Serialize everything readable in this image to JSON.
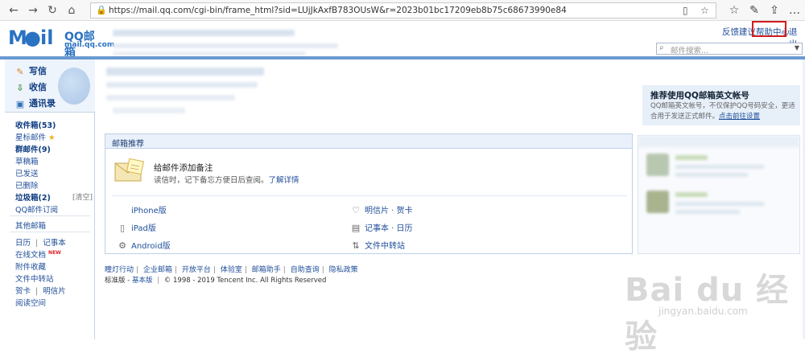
{
  "browser": {
    "url": "https://mail.qq.com/cgi-bin/frame_html?sid=LUjJkAxfB783OUsW&r=2023b01bc17209eb8b75c68673990e84"
  },
  "header": {
    "logo_text": "M",
    "logo_brand": "QQ邮箱",
    "logo_url": "mail.qq.com",
    "links": {
      "feedback": "反馈建议",
      "help": "帮助中心",
      "logout": "退出"
    },
    "search_placeholder": "邮件搜索..."
  },
  "sidebar": {
    "actions": {
      "compose": "写信",
      "inbox": "收信",
      "contacts": "通讯录"
    },
    "folders": [
      {
        "label": "收件箱(53)"
      },
      {
        "label": "星标邮件"
      },
      {
        "label": "群邮件(9)"
      },
      {
        "label": "草稿箱"
      },
      {
        "label": "已发送"
      },
      {
        "label": "已删除"
      },
      {
        "label": "垃圾箱(2)"
      },
      {
        "label": "QQ邮件订阅"
      }
    ],
    "clear_label": "[清空]",
    "other_mailbox": "其他邮箱",
    "tools": {
      "calendar": "日历",
      "notes": "记事本",
      "online_docs": "在线文档",
      "new_badge": "NEW",
      "attachments": "附件收藏",
      "file_transfer": "文件中转站",
      "cards": "贺卡",
      "postcards": "明信片",
      "reading": "阅读空间",
      "divider": "|"
    }
  },
  "panel": {
    "title": "邮箱推荐",
    "note_title": "给邮件添加备注",
    "note_desc": "读信时，记下备忘方便日后查阅。",
    "note_link": "了解详情",
    "features": {
      "iphone": "iPhone版",
      "ipad": "iPad版",
      "android": "Android版",
      "postcard": "明信片 · 贺卡",
      "notebook": "记事本 · 日历",
      "transfer": "文件中转站"
    }
  },
  "footer": {
    "links": [
      "瞳灯行动",
      "企业邮箱",
      "开放平台",
      "体验室",
      "邮箱助手",
      "自助查询",
      "隐私政策"
    ],
    "separator": "|",
    "version_standard": "标准版",
    "version_basic": "基本版",
    "copyright": "© 1998 - 2019 Tencent Inc. All Rights Reserved"
  },
  "recommend": {
    "title": "推荐使用QQ邮箱英文帐号",
    "text": "QQ邮箱英文帐号，不仅保护QQ号码安全，更适合用于发送正式邮件。",
    "link": "点击前往设置"
  },
  "watermark": {
    "big": "Bai du 经验",
    "small": "jingyan.baidu.com"
  }
}
